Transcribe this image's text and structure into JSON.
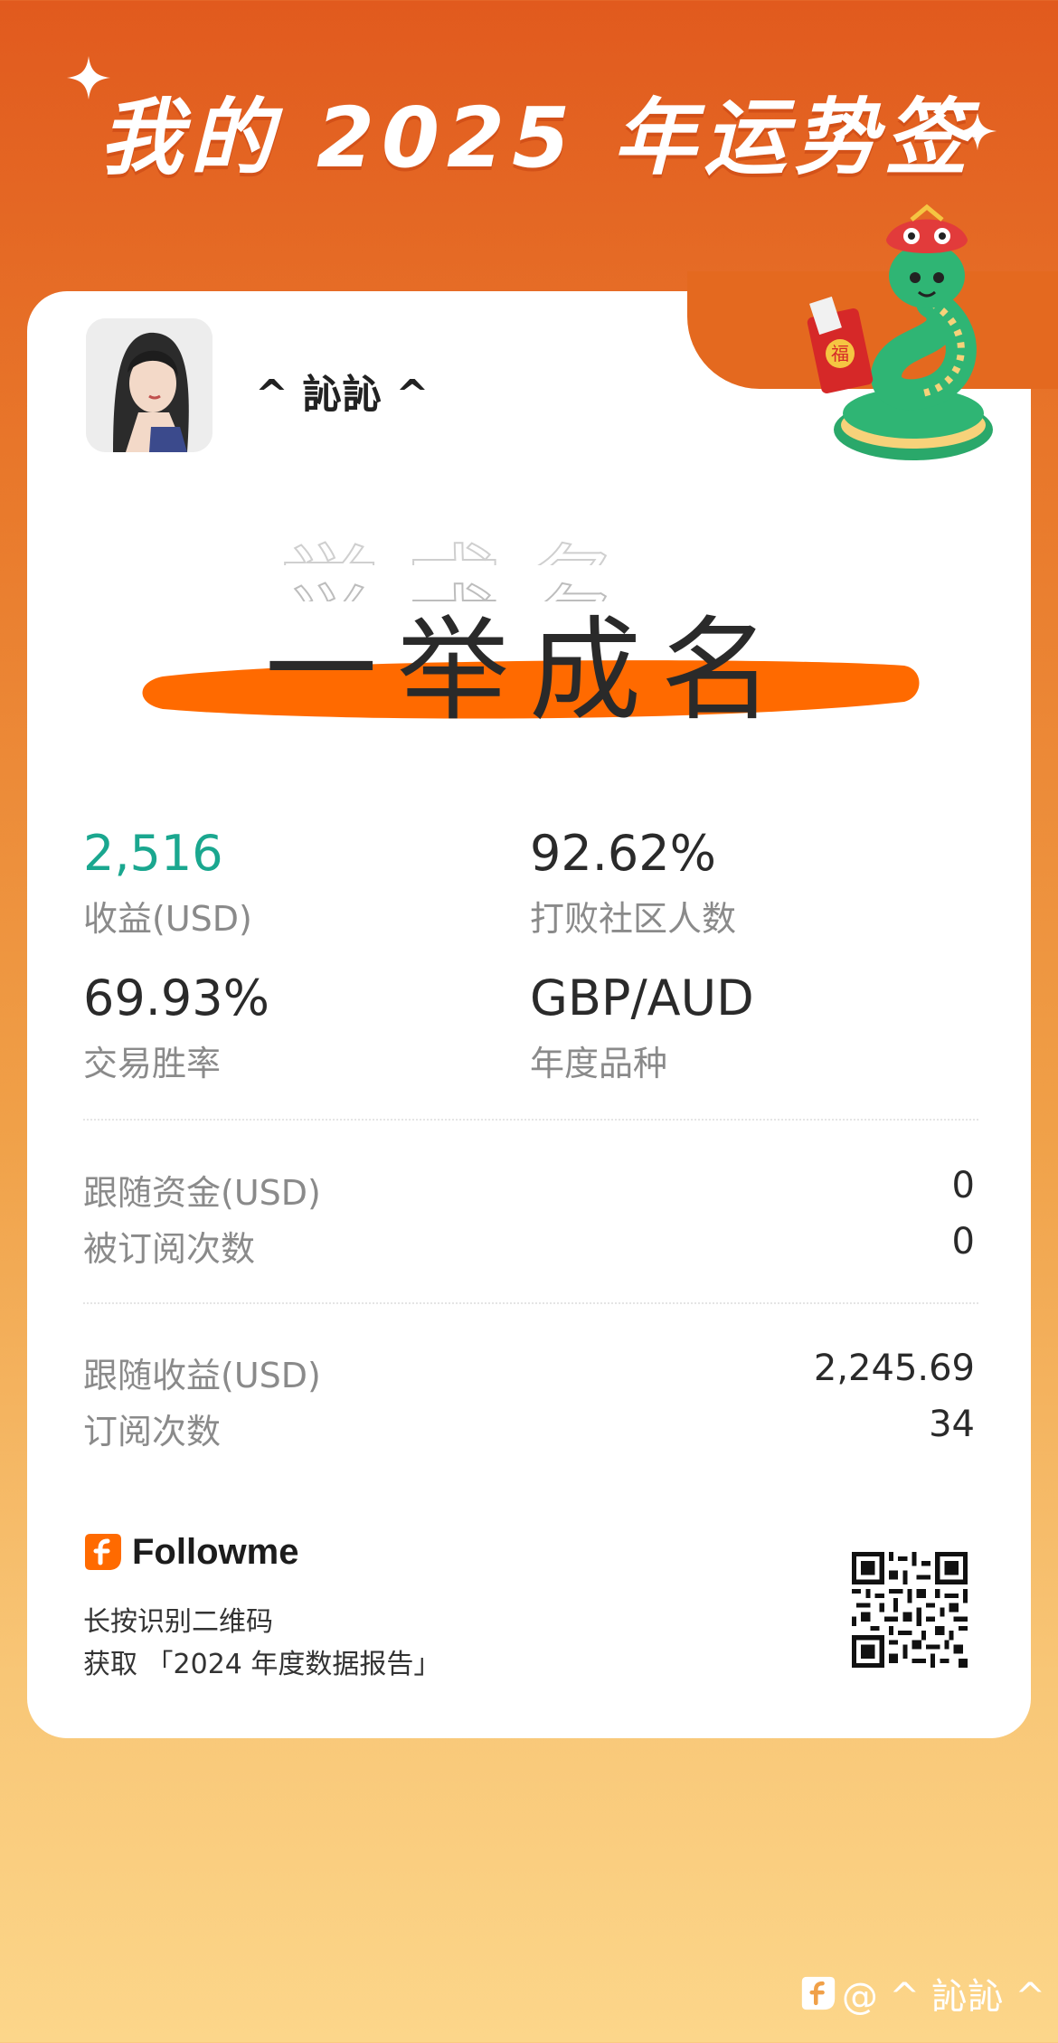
{
  "header": {
    "title": "我的 2025 年运势签"
  },
  "profile": {
    "username": "^ 訫訫 ^"
  },
  "fortune": {
    "phrase": "一举成名"
  },
  "stats": [
    {
      "value": "2,516",
      "label": "收益(USD)",
      "accent": "#1aa78f"
    },
    {
      "value": "92.62%",
      "label": "打败社区人数"
    },
    {
      "value": "69.93%",
      "label": "交易胜率"
    },
    {
      "value": "GBP/AUD",
      "label": "年度品种"
    }
  ],
  "follow_section": [
    {
      "label": "跟随资金(USD)",
      "value": "0"
    },
    {
      "label": "被订阅次数",
      "value": "0"
    }
  ],
  "earnings_section": [
    {
      "label": "跟随收益(USD)",
      "value": "2,245.69"
    },
    {
      "label": "订阅次数",
      "value": "34"
    }
  ],
  "footer": {
    "brand": "Followme",
    "line1": "长按识别二维码",
    "line2": "获取 「2024 年度数据报告」"
  },
  "watermark": {
    "text": "@ ^ 訫訫 ^"
  },
  "colors": {
    "brand_orange": "#e4691f",
    "brush_orange": "#ff6a00",
    "teal": "#1aa78f"
  }
}
